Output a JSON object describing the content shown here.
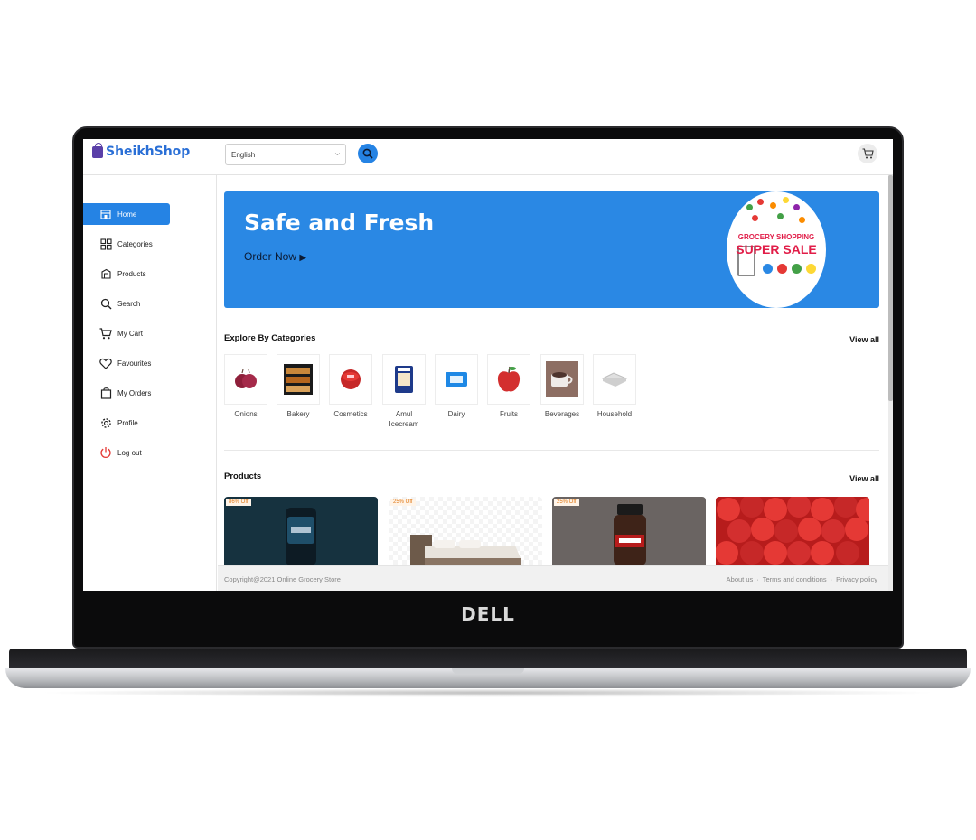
{
  "brand": {
    "name": "SheikhShop"
  },
  "header": {
    "language": "English",
    "search_icon": "search-icon",
    "cart_icon": "cart-icon"
  },
  "sidebar": {
    "items": [
      {
        "label": "Home",
        "icon": "store-icon",
        "active": true
      },
      {
        "label": "Categories",
        "icon": "grid-icon"
      },
      {
        "label": "Products",
        "icon": "box-icon"
      },
      {
        "label": "Search",
        "icon": "search-icon"
      },
      {
        "label": "My Cart",
        "icon": "cart-icon"
      },
      {
        "label": "Favourites",
        "icon": "heart-icon"
      },
      {
        "label": "My Orders",
        "icon": "bag-icon"
      },
      {
        "label": "Profile",
        "icon": "gear-icon"
      },
      {
        "label": "Log out",
        "icon": "power-icon"
      }
    ]
  },
  "hero": {
    "title": "Safe and Fresh",
    "cta": "Order Now",
    "badge_line1": "GROCERY SHOPPING",
    "badge_line2": "SUPER SALE"
  },
  "categories": {
    "title": "Explore By Categories",
    "view_all": "View all",
    "items": [
      {
        "label": "Onions"
      },
      {
        "label": "Bakery"
      },
      {
        "label": "Cosmetics"
      },
      {
        "label": "Amul Icecream"
      },
      {
        "label": "Dairy"
      },
      {
        "label": "Fruits"
      },
      {
        "label": "Beverages"
      },
      {
        "label": "Household"
      }
    ]
  },
  "products": {
    "title": "Products",
    "view_all": "View all",
    "items": [
      {
        "badge": "86% Off"
      },
      {
        "badge": "25% Off"
      },
      {
        "badge": "25% Off"
      },
      {
        "badge": ""
      }
    ]
  },
  "footer": {
    "copyright": "Copyright@2021 Online Grocery Store",
    "links": [
      "About us",
      "Terms and conditions",
      "Privacy policy"
    ],
    "separator": "·"
  },
  "device": {
    "brand": "DELL"
  },
  "colors": {
    "accent": "#2583e4",
    "hero": "#2a88e4",
    "brand": "#2a6fd6"
  }
}
